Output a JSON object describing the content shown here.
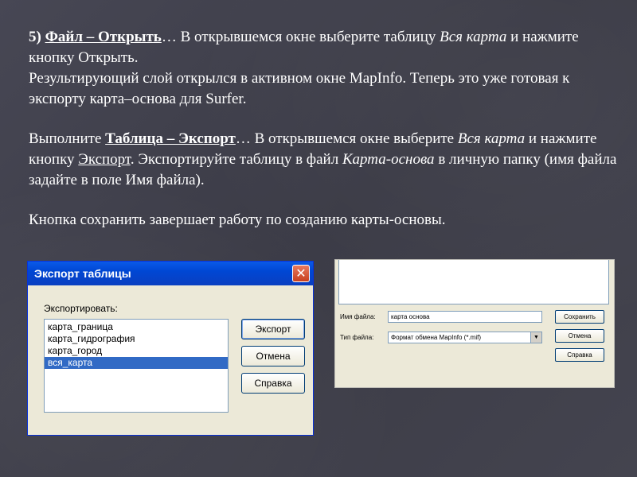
{
  "text": {
    "p1_num": "5) ",
    "p1_menu": "Файл – Открыть",
    "p1_dots": "… ",
    "p1_a": "В открывшемся окне выберите таблицу ",
    "p1_table": "Вся карта",
    "p1_b": " и нажмите кнопку Открыть.",
    "p2": "Результирующий слой открылся в активном окне MapInfo. Теперь это уже готовая к экспорту карта–основа для Surfer.",
    "p3_a": "Выполните ",
    "p3_menu": "Таблица – Экспорт",
    "p3_dots": "…",
    "p3_b": " В открывшемся окне выберите ",
    "p3_table": "Вся карта",
    "p3_c": " и нажмите кнопку ",
    "p3_btn": "Экспорт",
    "p3_d": ". Экспортируйте таблицу в файл ",
    "p3_file": "Карта-основа",
    "p3_e": " в личную папку (имя файла задайте в поле Имя файла).",
    "p4": "Кнопка сохранить завершает работу по созданию карты-основы."
  },
  "export_dialog": {
    "title": "Экспорт таблицы",
    "close_glyph": "✕",
    "export_label": "Экспортировать:",
    "items": [
      "карта_граница",
      "карта_гидрография",
      "карта_город",
      "вся_карта"
    ],
    "selected_index": 3,
    "btn_export": "Экспорт",
    "btn_cancel": "Отмена",
    "btn_help": "Справка"
  },
  "save_dialog": {
    "filename_label": "Имя файла:",
    "filename_value": "карта основа",
    "filetype_label": "Тип файла:",
    "filetype_value": "Формат обмена MapInfo (*.mif)",
    "dropdown_glyph": "▼",
    "btn_save": "Сохранить",
    "btn_cancel": "Отмена",
    "btn_help": "Справка"
  }
}
